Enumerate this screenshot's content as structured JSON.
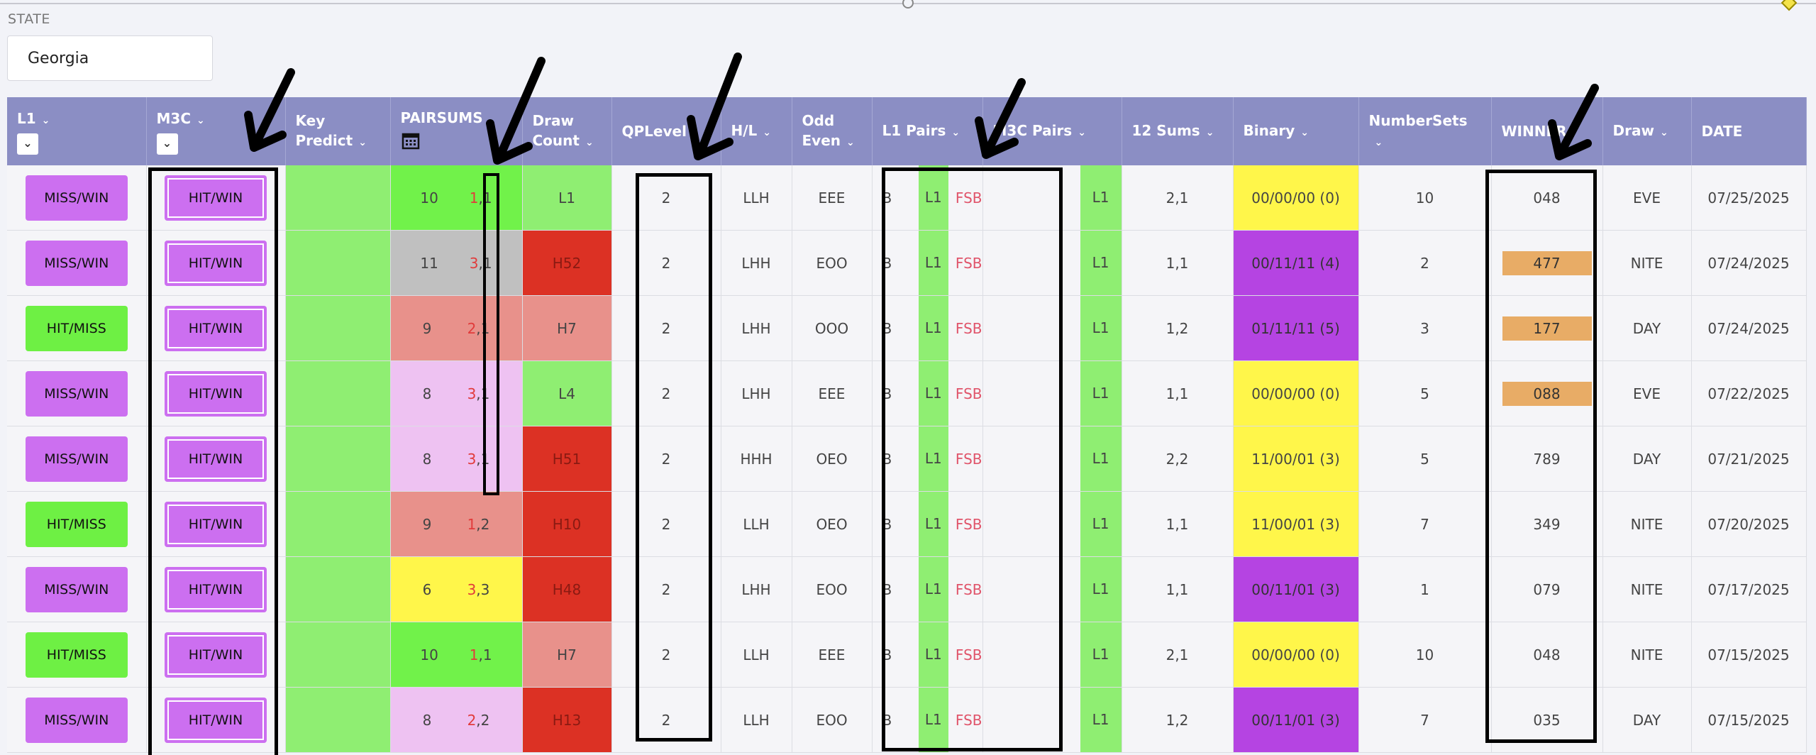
{
  "state": {
    "label": "STATE",
    "value": "Georgia"
  },
  "headers": {
    "l1": "L1",
    "m3c": "M3C",
    "key_predict_1": "Key",
    "key_predict_2": "Predict",
    "pairsums": "PAIRSUMS",
    "draw_count_1": "Draw",
    "draw_count_2": "Count",
    "qplevel": "QPLevel",
    "hl": "H/L",
    "odd_even_1": "Odd",
    "odd_even_2": "Even",
    "l1_pairs": "L1 Pairs",
    "m3c_pairs": "M3C Pairs",
    "sums12": "12 Sums",
    "binary": "Binary",
    "numbersets": "NumberSets",
    "winner": "WINNER",
    "draw": "Draw",
    "date": "DATE"
  },
  "rows": [
    {
      "l1": "MISS/WIN",
      "m3c": "HIT/WIN",
      "ps_sum": "10",
      "ps_a": "1",
      "ps_b": "1",
      "draw_count": "L1",
      "qp": "2",
      "hl": "LLH",
      "oe": "EEE",
      "pair_b": "B",
      "pair_l1": "L1",
      "pair_fsb": "FSB",
      "m3c_l1": "L1",
      "sums": "2,1",
      "binary": "00/00/00 (0)",
      "nsets": "10",
      "winner": "048",
      "draw": "EVE",
      "date": "07/25/2025"
    },
    {
      "l1": "MISS/WIN",
      "m3c": "HIT/WIN",
      "ps_sum": "11",
      "ps_a": "3",
      "ps_b": "1",
      "draw_count": "H52",
      "qp": "2",
      "hl": "LHH",
      "oe": "EOO",
      "pair_b": "B",
      "pair_l1": "L1",
      "pair_fsb": "FSB",
      "m3c_l1": "L1",
      "sums": "1,1",
      "binary": "00/11/11 (4)",
      "nsets": "2",
      "winner": "477",
      "draw": "NITE",
      "date": "07/24/2025"
    },
    {
      "l1": "HIT/MISS",
      "m3c": "HIT/WIN",
      "ps_sum": "9",
      "ps_a": "2",
      "ps_b": "1",
      "draw_count": "H7",
      "qp": "2",
      "hl": "LHH",
      "oe": "OOO",
      "pair_b": "B",
      "pair_l1": "L1",
      "pair_fsb": "FSB",
      "m3c_l1": "L1",
      "sums": "1,2",
      "binary": "01/11/11 (5)",
      "nsets": "3",
      "winner": "177",
      "draw": "DAY",
      "date": "07/24/2025"
    },
    {
      "l1": "MISS/WIN",
      "m3c": "HIT/WIN",
      "ps_sum": "8",
      "ps_a": "3",
      "ps_b": "1",
      "draw_count": "L4",
      "qp": "2",
      "hl": "LHH",
      "oe": "EEE",
      "pair_b": "B",
      "pair_l1": "L1",
      "pair_fsb": "FSB",
      "m3c_l1": "L1",
      "sums": "1,1",
      "binary": "00/00/00 (0)",
      "nsets": "5",
      "winner": "088",
      "draw": "EVE",
      "date": "07/22/2025"
    },
    {
      "l1": "MISS/WIN",
      "m3c": "HIT/WIN",
      "ps_sum": "8",
      "ps_a": "3",
      "ps_b": "1",
      "draw_count": "H51",
      "qp": "2",
      "hl": "HHH",
      "oe": "OEO",
      "pair_b": "B",
      "pair_l1": "L1",
      "pair_fsb": "FSB",
      "m3c_l1": "L1",
      "sums": "2,2",
      "binary": "11/00/01 (3)",
      "nsets": "5",
      "winner": "789",
      "draw": "DAY",
      "date": "07/21/2025"
    },
    {
      "l1": "HIT/MISS",
      "m3c": "HIT/WIN",
      "ps_sum": "9",
      "ps_a": "1",
      "ps_b": "2",
      "draw_count": "H10",
      "qp": "2",
      "hl": "LLH",
      "oe": "OEO",
      "pair_b": "B",
      "pair_l1": "L1",
      "pair_fsb": "FSB",
      "m3c_l1": "L1",
      "sums": "1,1",
      "binary": "11/00/01 (3)",
      "nsets": "7",
      "winner": "349",
      "draw": "NITE",
      "date": "07/20/2025"
    },
    {
      "l1": "MISS/WIN",
      "m3c": "HIT/WIN",
      "ps_sum": "6",
      "ps_a": "3",
      "ps_b": "3",
      "draw_count": "H48",
      "qp": "2",
      "hl": "LHH",
      "oe": "EOO",
      "pair_b": "B",
      "pair_l1": "L1",
      "pair_fsb": "FSB",
      "m3c_l1": "L1",
      "sums": "1,1",
      "binary": "00/11/01 (3)",
      "nsets": "1",
      "winner": "079",
      "draw": "NITE",
      "date": "07/17/2025"
    },
    {
      "l1": "HIT/MISS",
      "m3c": "HIT/WIN",
      "ps_sum": "10",
      "ps_a": "1",
      "ps_b": "1",
      "draw_count": "H7",
      "qp": "2",
      "hl": "LLH",
      "oe": "EEE",
      "pair_b": "B",
      "pair_l1": "L1",
      "pair_fsb": "FSB",
      "m3c_l1": "L1",
      "sums": "2,1",
      "binary": "00/00/00 (0)",
      "nsets": "10",
      "winner": "048",
      "draw": "NITE",
      "date": "07/15/2025"
    },
    {
      "l1": "MISS/WIN",
      "m3c": "HIT/WIN",
      "ps_sum": "8",
      "ps_a": "2",
      "ps_b": "2",
      "draw_count": "H13",
      "qp": "2",
      "hl": "LLH",
      "oe": "EOO",
      "pair_b": "B",
      "pair_l1": "L1",
      "pair_fsb": "FSB",
      "m3c_l1": "L1",
      "sums": "1,2",
      "binary": "00/11/01 (3)",
      "nsets": "7",
      "winner": "035",
      "draw": "DAY",
      "date": "07/15/2025"
    }
  ],
  "colors": {
    "header_bg": "#8b8ec4",
    "miss_win": "#cc6ff0",
    "hit_miss": "#6ef044",
    "key_predict": "#8fee72",
    "binary_yellow": "#fff64a",
    "binary_purple": "#b544e2",
    "draw_count_red": "#dc3124",
    "winner_highlight": "#e8ac66",
    "annotation": "#000000"
  },
  "row_styles": {
    "l1_btn": [
      "mw",
      "mw",
      "hm",
      "mw",
      "mw",
      "hm",
      "mw",
      "hm",
      "mw"
    ],
    "pairsums_bg": [
      "c-lime",
      "c-gray",
      "c-salmon",
      "c-pink",
      "c-pink",
      "c-salmon",
      "c-yellow",
      "c-lime",
      "c-pink"
    ],
    "draw_count_bg": [
      "c-green",
      "c-red",
      "c-salmon",
      "c-green",
      "c-red",
      "c-red",
      "c-red",
      "c-salmon",
      "c-red"
    ],
    "binary_bg": [
      "c-yellow",
      "c-purple",
      "c-purple",
      "c-yellow",
      "c-yellow",
      "c-yellow",
      "c-purple",
      "c-yellow",
      "c-purple"
    ],
    "winner_highlighted": [
      false,
      true,
      true,
      true,
      false,
      false,
      false,
      false,
      false
    ]
  }
}
